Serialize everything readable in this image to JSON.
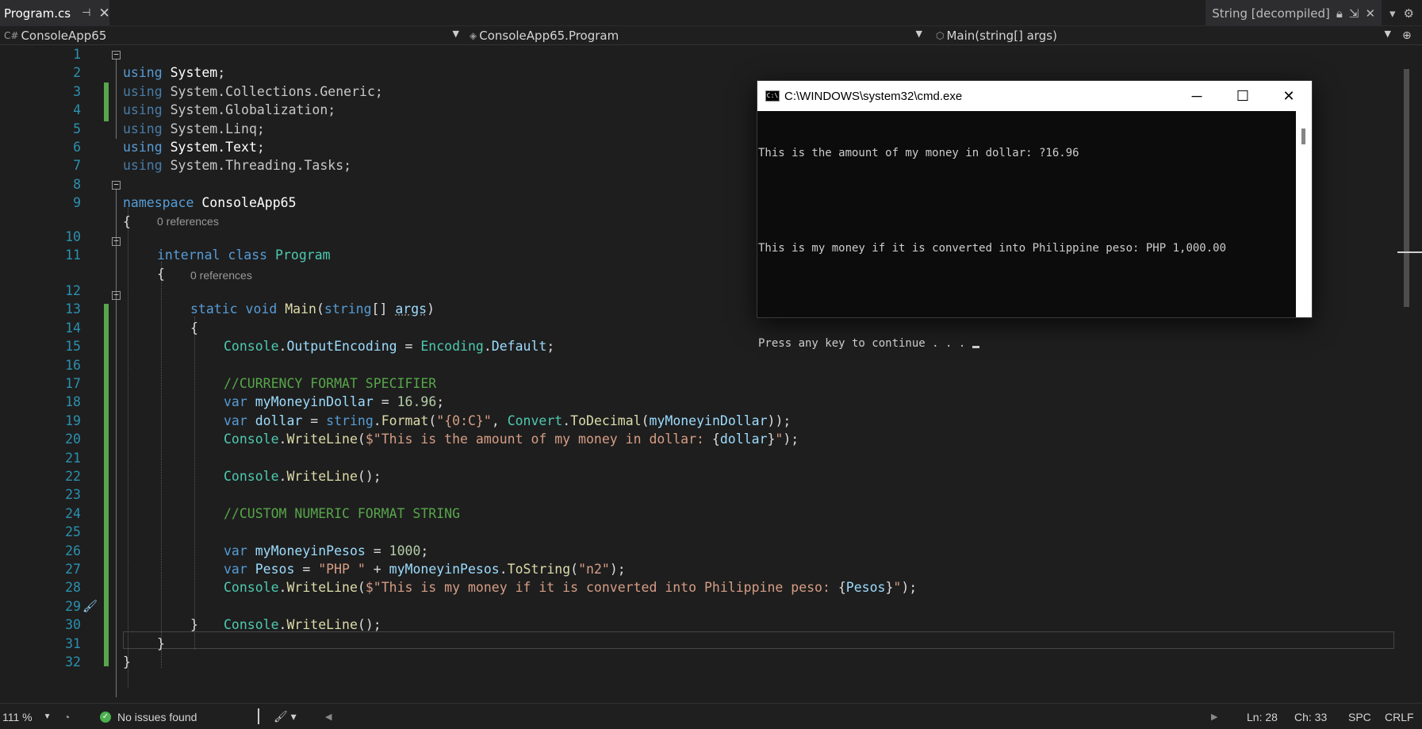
{
  "tab": {
    "title": "Program.cs",
    "pin_icon": "pin-icon",
    "close_icon": "close-icon"
  },
  "decompiled_tab": {
    "title": "String [decompiled]"
  },
  "navbar": {
    "project": "ConsoleApp65",
    "class": "ConsoleApp65.Program",
    "member": "Main(string[] args)"
  },
  "editor": {
    "references_label": "0 references",
    "line_numbers": [
      "1",
      "2",
      "3",
      "4",
      "5",
      "6",
      "7",
      "8",
      "9",
      "10",
      "11",
      "12",
      "13",
      "14",
      "15",
      "16",
      "17",
      "18",
      "19",
      "20",
      "21",
      "22",
      "23",
      "24",
      "25",
      "26",
      "27",
      "28",
      "29",
      "30",
      "31",
      "32"
    ]
  },
  "code": {
    "l1": [
      "using",
      " ",
      "System",
      ";"
    ],
    "l2": [
      "using",
      " System.",
      "Collections",
      ".",
      "Generic",
      ";"
    ],
    "l3": [
      "using",
      " System.",
      "Globalization",
      ";"
    ],
    "l4": [
      "using",
      " System.",
      "Linq",
      ";"
    ],
    "l5": [
      "using",
      " System.",
      "Text",
      ";"
    ],
    "l6": [
      "using",
      " System.",
      "Threading",
      ".",
      "Tasks",
      ";"
    ],
    "l8": [
      "namespace",
      " ConsoleApp65"
    ],
    "l9": "{",
    "l10": [
      "internal",
      " ",
      "class",
      " ",
      "Program"
    ],
    "l11": "{",
    "l12": [
      "static",
      " ",
      "void",
      " ",
      "Main",
      "(",
      "string",
      "[] ",
      "args",
      ")"
    ],
    "l13": "{",
    "l14": [
      "Console",
      ".",
      "OutputEncoding",
      " = ",
      "Encoding",
      ".",
      "Default",
      ";"
    ],
    "l16": "//CURRENCY FORMAT SPECIFIER",
    "l17": [
      "var",
      " ",
      "myMoneyinDollar",
      " = ",
      "16.96",
      ";"
    ],
    "l18": [
      "var",
      " ",
      "dollar",
      " = ",
      "string",
      ".",
      "Format",
      "(",
      "\"{0:C}\"",
      ", ",
      "Convert",
      ".",
      "ToDecimal",
      "(",
      "myMoneyinDollar",
      "));"
    ],
    "l19": [
      "Console",
      ".",
      "WriteLine",
      "(",
      "$\"This is the amount of my money in dollar: ",
      "{",
      "dollar",
      "}",
      "\"",
      ");"
    ],
    "l21": [
      "Console",
      ".",
      "WriteLine",
      "();"
    ],
    "l23": "//CUSTOM NUMERIC FORMAT STRING",
    "l25": [
      "var",
      " ",
      "myMoneyinPesos",
      " = ",
      "1000",
      ";"
    ],
    "l26": [
      "var",
      " ",
      "Pesos",
      " = ",
      "\"PHP \"",
      " + ",
      "myMoneyinPesos",
      ".",
      "ToString",
      "(",
      "\"n2\"",
      ");"
    ],
    "l27": [
      "Console",
      ".",
      "WriteLine",
      "(",
      "$\"This is my money if it is converted into Philippine peso: ",
      "{",
      "Pesos",
      "}",
      "\"",
      ");"
    ],
    "l28": [
      "Console",
      ".",
      "WriteLine",
      "();"
    ],
    "l29": "}",
    "l30": "}",
    "l31": "}"
  },
  "cmd": {
    "title": "C:\\WINDOWS\\system32\\cmd.exe",
    "icon_label": "C:\\",
    "output": [
      "This is the amount of my money in dollar: ?16.96",
      "",
      "This is my money if it is converted into Philippine peso: PHP 1,000.00",
      "",
      "Press any key to continue . . . "
    ],
    "minimize_glyph": "─",
    "maximize_glyph": "☐",
    "close_glyph": "✕"
  },
  "status": {
    "zoom": "111 %",
    "issues": "No issues found",
    "line": "Ln: 28",
    "col": "Ch: 33",
    "whitespace": "SPC",
    "line_ending": "CRLF"
  }
}
